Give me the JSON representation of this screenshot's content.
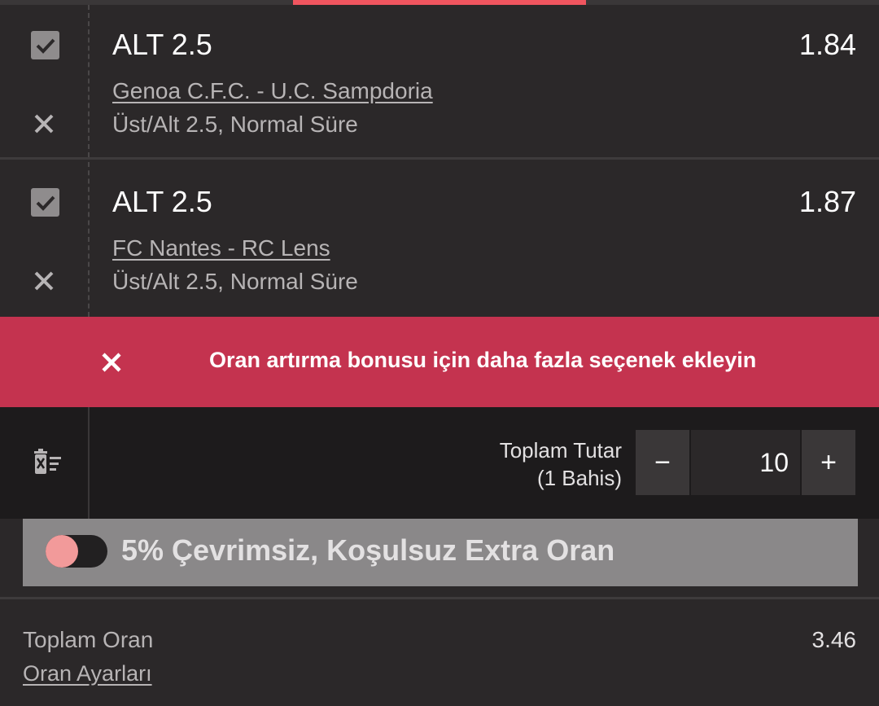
{
  "tabs": {
    "active_index": 1,
    "count": 3
  },
  "bets": [
    {
      "pick": "ALT 2.5",
      "odds": "1.84",
      "match": "Genoa C.F.C. - U.C. Sampdoria",
      "market": "Üst/Alt 2.5, Normal Süre",
      "selected": true
    },
    {
      "pick": "ALT 2.5",
      "odds": "1.87",
      "match": "FC Nantes - RC Lens",
      "market": "Üst/Alt 2.5, Normal Süre",
      "selected": true
    }
  ],
  "banner": {
    "message": "Oran artırma bonusu için daha fazla seçenek ekleyin",
    "color": "#c4334f"
  },
  "stake": {
    "label_line1": "Toplam Tutar",
    "label_line2": "(1 Bahis)",
    "value": "10",
    "minus": "−",
    "plus": "+"
  },
  "extra_odds": {
    "label": "5% Çevrimsiz, Koşulsuz Extra Oran",
    "enabled": false
  },
  "summary": {
    "total_label": "Toplam Oran",
    "total_value": "3.46",
    "settings_link": "Oran Ayarları"
  },
  "colors": {
    "accent": "#f0555f",
    "background": "#2b2829",
    "banner": "#c4334f"
  }
}
